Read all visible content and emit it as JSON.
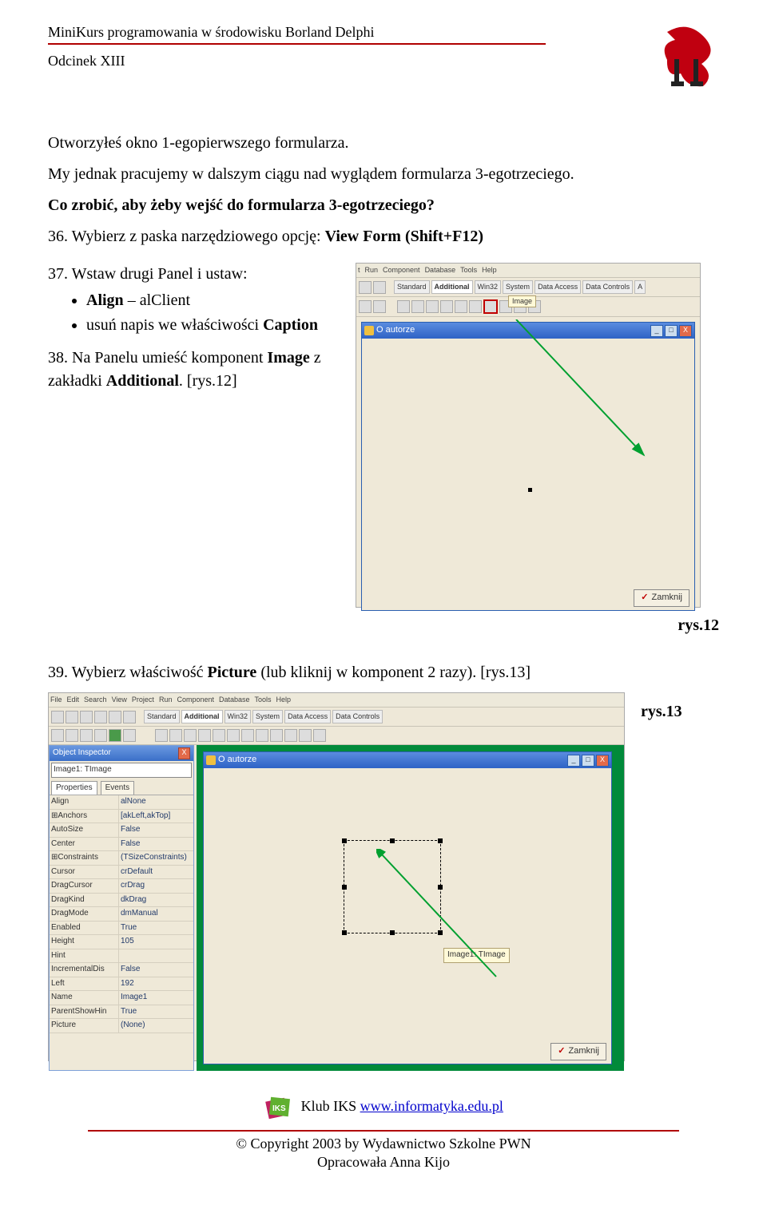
{
  "header": {
    "title": "MiniKurs programowania w środowisku Borland Delphi",
    "episode": "Odcinek XIII"
  },
  "body": {
    "p1": "Otworzyłeś okno 1-egopierwszego formularza.",
    "p2": "My jednak pracujemy w dalszym ciągu nad wyglądem formularza 3-egotrzeciego.",
    "q": "Co zrobić, aby żeby wejść do formularza 3-egotrzeciego?",
    "step36_pre": "36. Wybierz z paska narzędziowego opcję: ",
    "step36_bold": "View Form (Shift+F12)",
    "step37_pre": "37. Wstaw drugi Panel i ustaw:",
    "step37_bullet1_pre": "Align",
    "step37_bullet1_post": " – alClient",
    "step37_bullet2_pre": "usuń napis we właściwości ",
    "step37_bullet2_bold": "Caption",
    "step38_pre": "38. Na Panelu umieść komponent ",
    "step38_bold1": "Image",
    "step38_mid": " z zakładki ",
    "step38_bold2": "Additional",
    "step38_post": ". [rys.12]",
    "fig12": "rys.12",
    "step39_pre": "39. Wybierz właściwość ",
    "step39_bold": "Picture",
    "step39_post": " (lub kliknij w komponent 2 razy). [rys.13]",
    "fig13": "rys.13"
  },
  "ss12": {
    "menu": [
      "t",
      "Run",
      "Component",
      "Database",
      "Tools",
      "Help"
    ],
    "tabs": [
      "Standard",
      "Additional",
      "Win32",
      "System",
      "Data Access",
      "Data Controls",
      "A"
    ],
    "tooltip": "Image",
    "form_title": "O autorze",
    "close_btn": "Zamknij"
  },
  "ss13": {
    "menu": [
      "File",
      "Edit",
      "Search",
      "View",
      "Project",
      "Run",
      "Component",
      "Database",
      "Tools",
      "Help"
    ],
    "tabs": [
      "Standard",
      "Additional",
      "Win32",
      "System",
      "Data Access",
      "Data Controls"
    ],
    "oi_title": "Object Inspector",
    "oi_combo": "Image1: TImage",
    "oi_tab1": "Properties",
    "oi_tab2": "Events",
    "props": [
      {
        "n": "Align",
        "v": "alNone"
      },
      {
        "n": "⊞Anchors",
        "v": "[akLeft,akTop]"
      },
      {
        "n": "AutoSize",
        "v": "False"
      },
      {
        "n": "Center",
        "v": "False"
      },
      {
        "n": "⊞Constraints",
        "v": "(TSizeConstraints)"
      },
      {
        "n": "Cursor",
        "v": "crDefault"
      },
      {
        "n": "DragCursor",
        "v": "crDrag"
      },
      {
        "n": "DragKind",
        "v": "dkDrag"
      },
      {
        "n": "DragMode",
        "v": "dmManual"
      },
      {
        "n": "Enabled",
        "v": "True"
      },
      {
        "n": "Height",
        "v": "105"
      },
      {
        "n": "Hint",
        "v": ""
      },
      {
        "n": "IncrementalDis",
        "v": "False"
      },
      {
        "n": "Left",
        "v": "192"
      },
      {
        "n": "Name",
        "v": "Image1"
      },
      {
        "n": "ParentShowHin",
        "v": "True"
      },
      {
        "n": "Picture",
        "v": "(None)"
      }
    ],
    "form_title": "O autorze",
    "hint": "Image1: TImage",
    "close_btn": "Zamknij"
  },
  "footer": {
    "club": "Klub IKS ",
    "url": "www.informatyka.edu.pl",
    "copyright1": "© Copyright 2003 by Wydawnictwo Szkolne PWN",
    "copyright2": "Opracowała Anna Kijo"
  }
}
